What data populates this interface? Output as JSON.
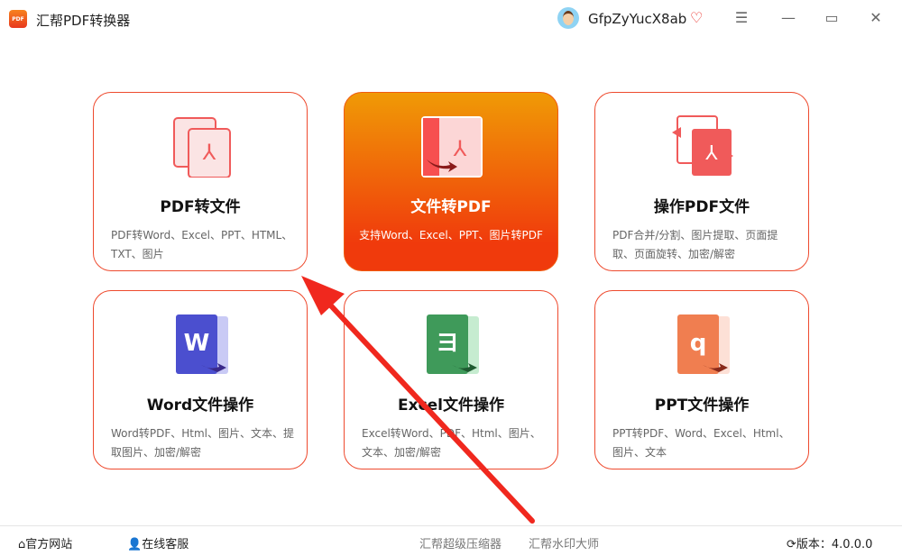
{
  "app": {
    "title": "汇帮PDF转换器",
    "logo_text": "PDF",
    "username": "GfpZyYucX8ab"
  },
  "window_controls": {
    "menu": "☰",
    "minimize": "—",
    "maximize": "▭",
    "close": "✕"
  },
  "cards": [
    {
      "title": "PDF转文件",
      "desc": "PDF转Word、Excel、PPT、HTML、TXT、图片",
      "icon": "pdf-to-file-icon"
    },
    {
      "title": "文件转PDF",
      "desc": "支持Word、Excel、PPT、图片转PDF",
      "icon": "file-to-pdf-icon",
      "active": true
    },
    {
      "title": "操作PDF文件",
      "desc": "PDF合并/分割、图片提取、页面提取、页面旋转、加密/解密",
      "icon": "pdf-operate-icon"
    },
    {
      "title": "Word文件操作",
      "desc": "Word转PDF、Html、图片、文本、提取图片、加密/解密",
      "icon": "word-icon"
    },
    {
      "title": "Excel文件操作",
      "desc": "Excel转Word、PDF、Html、图片、文本、加密/解密",
      "icon": "excel-icon"
    },
    {
      "title": "PPT文件操作",
      "desc": "PPT转PDF、Word、Excel、Html、图片、文本",
      "icon": "ppt-icon"
    }
  ],
  "footer": {
    "website": "官方网站",
    "support": "在线客服",
    "compressor": "汇帮超级压缩器",
    "watermark": "汇帮水印大师",
    "version": "版本：4.0.0.0"
  },
  "colors": {
    "accent": "#ee4a2e",
    "active_top": "#f09a06",
    "active_bottom": "#f03a0c",
    "word": "#4b4fcf",
    "excel": "#3f9a5a",
    "ppt": "#f07e50",
    "annotation_arrow": "#f0281e"
  }
}
